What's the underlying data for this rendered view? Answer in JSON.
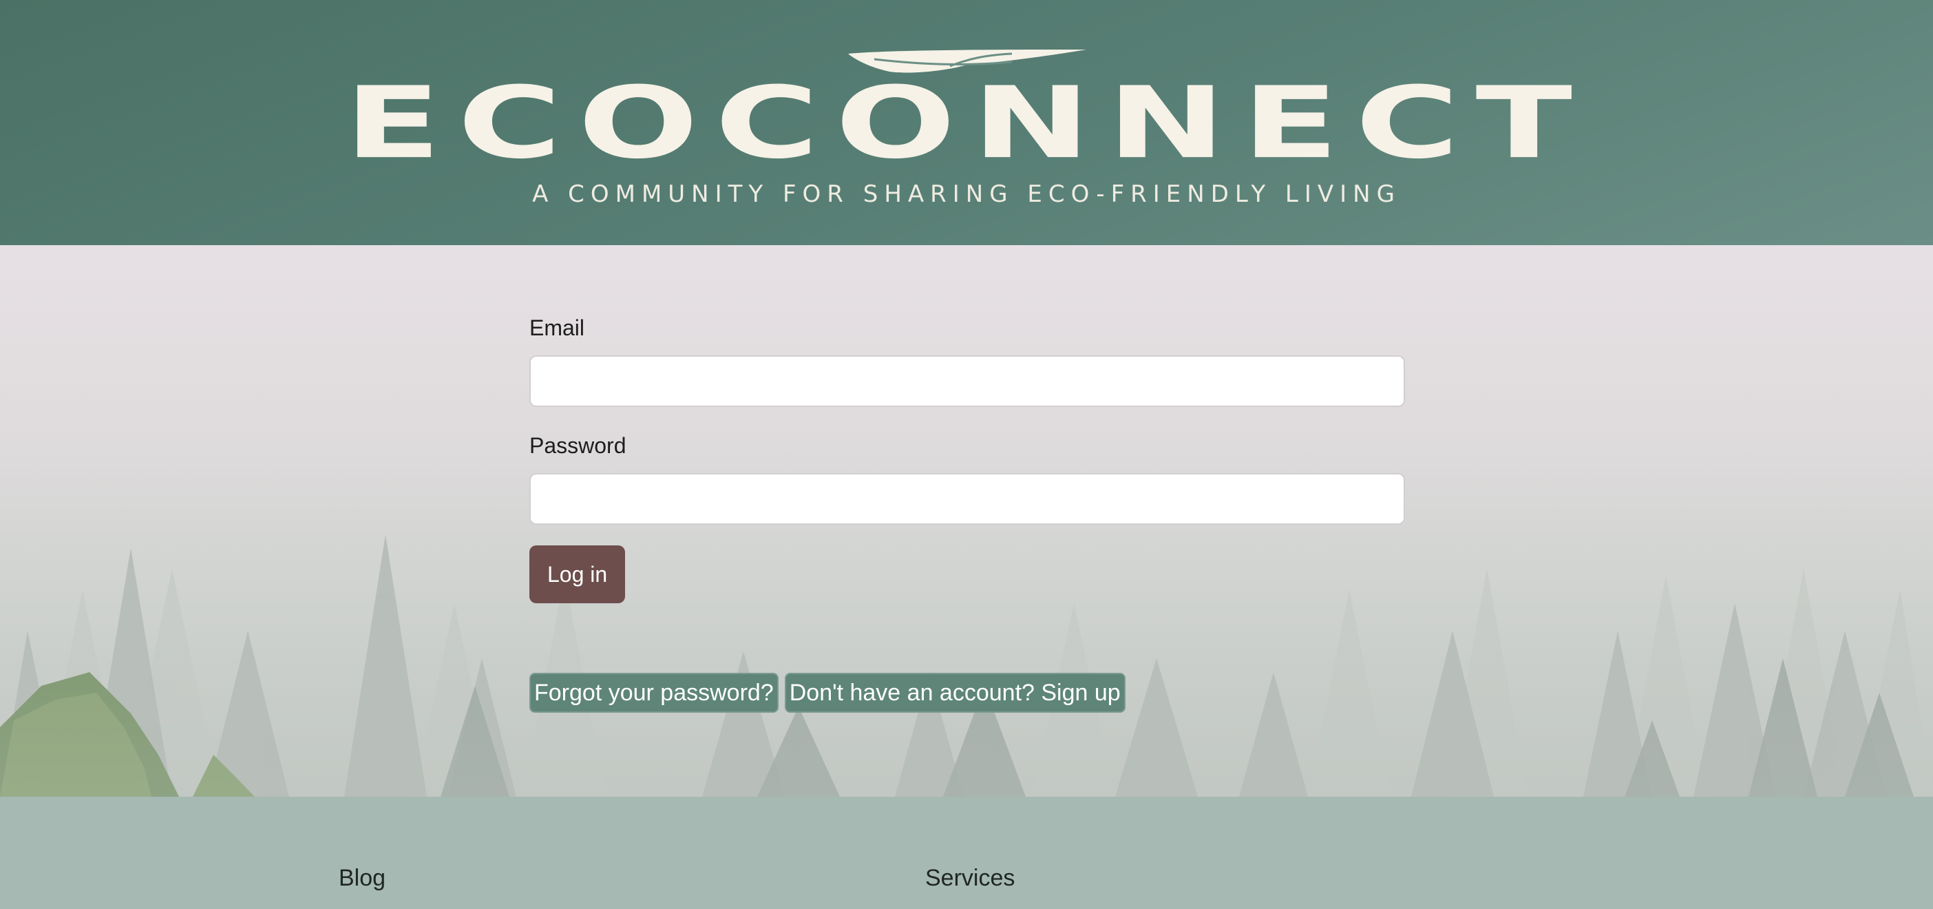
{
  "header": {
    "logo_title": "ECOCONNECT",
    "logo_tagline": "A COMMUNITY FOR SHARING ECO-FRIENDLY LIVING",
    "logo_icon": "leaf-icon"
  },
  "login_form": {
    "email_label": "Email",
    "email_value": "",
    "password_label": "Password",
    "password_value": "",
    "login_button_label": "Log in",
    "forgot_password_label": "Forgot your password?",
    "signup_label": "Don't have an account? Sign up"
  },
  "footer": {
    "links": [
      "Blog",
      "Services"
    ]
  },
  "colors": {
    "header_bg": "#4b7166",
    "logo_text": "#f6f2e7",
    "login_button": "#6d4e4c",
    "link_button": "#5e8578",
    "footer_bg": "#a6b9b3"
  }
}
